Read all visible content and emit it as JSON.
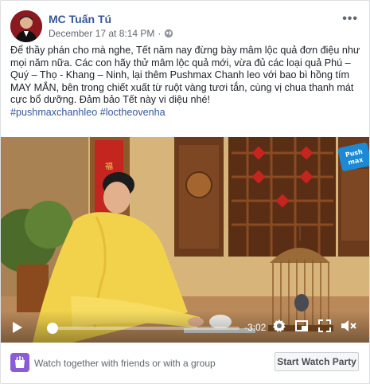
{
  "post": {
    "author": "MC Tuấn Tú",
    "date": "December 17 at 8:14 PM",
    "separator": "·",
    "more_label": "•••",
    "body": "Để thầy phán cho mà nghe, Tết năm nay đừng bày mâm lộc quả đơn điệu như mọi năm nữa. Các con hãy thử mâm lộc quả mới, vừa đủ các loại quả Phú – Quý – Thọ - Khang – Ninh, lại thêm Pushmax Chanh leo với bao bì hồng tím MAY MẮN, bên trong chiết xuất từ ruột vàng tươi tắn, cùng vị chua thanh mát cực bổ dưỡng. Đảm bảo Tết này vi diệu nhé!",
    "hashtags": [
      "#pushmaxchanhleo",
      "#loctheovenha"
    ]
  },
  "video": {
    "time_remaining": "-3:02",
    "progress": 0.02,
    "corner_logo_text": "Push\nmax"
  },
  "watch_party": {
    "text": "Watch together with friends or with a group",
    "button_label": "Start Watch Party"
  },
  "colors": {
    "link": "#365899",
    "watch_icon": "#8b5cd6"
  }
}
